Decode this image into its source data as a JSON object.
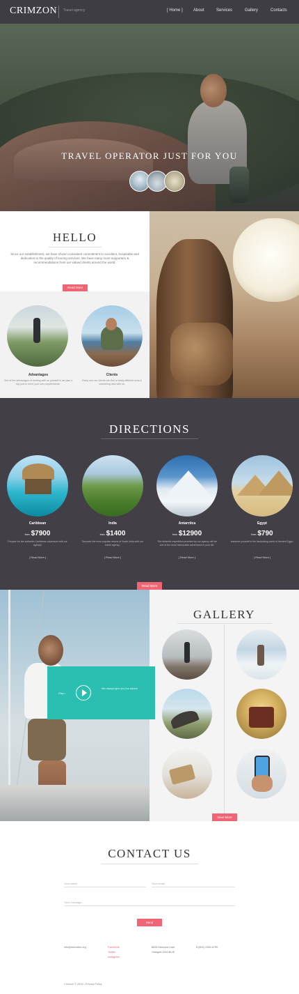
{
  "nav": {
    "brand": "CRIMZON",
    "tagline": "Travel agency",
    "items": [
      "[ Home ]",
      "About",
      "Services",
      "Gallery",
      "Contacts"
    ]
  },
  "hero": {
    "title": "TRAVEL OPERATOR JUST FOR YOU"
  },
  "hello": {
    "title": "HELLO",
    "text": "Since our establishment, we have shown consistent commitment to excellent, hospitable and dedication to the quality of touring services. We have many more supporters & recommendations from our valued clients around the world.",
    "button": "Read More",
    "features": [
      {
        "title": "Advantages",
        "text": "One of the advantages of dealing with us yourself is we plan a trip just to meet your own requirements."
      },
      {
        "title": "Clients",
        "text": "Every one our clients can find a totally different area & something new with us."
      }
    ]
  },
  "directions": {
    "title": "DIRECTIONS",
    "from_label": "from",
    "items": [
      {
        "name": "Caribbean",
        "price": "$7900",
        "text": "Prepare for the authentic Caribbean adventure with our agency!",
        "more": "[ Read More ]"
      },
      {
        "name": "India",
        "price": "$1400",
        "text": "Discover the most popular resorts of South India with our travel agency.",
        "more": "[ Read More ]"
      },
      {
        "name": "Antarctica",
        "price": "$12900",
        "text": "The Antarctic expedition provided by our agency will be one of the most memorable adventures in your life.",
        "more": "[ Read More ]"
      },
      {
        "name": "Egypt",
        "price": "$790",
        "text": "Immerse yourself in the fascinating world of Ancient Egypt.",
        "more": "[ Read More ]"
      }
    ],
    "button": "Read More"
  },
  "video": {
    "small_text": "Play •",
    "text": "We always give you fun advice"
  },
  "gallery": {
    "title": "GALLERY",
    "button": "View More"
  },
  "contact": {
    "title": "CONTACT US",
    "name_placeholder": "Your name",
    "email_placeholder": "Your email",
    "message_placeholder": "Your message",
    "send": "Send",
    "email": "info@demolink.org",
    "social": [
      "Facebook",
      "Twitter",
      "Instagram"
    ],
    "address": [
      "8628 Marcona road",
      "Glasgow DA4 8KJE"
    ],
    "phone": "8 (800) 2345-6790",
    "copyright": "Crimzon © 2016 • Privacy Policy"
  },
  "colors": {
    "accent": "#ef6574",
    "teal": "#2abfb1",
    "dark": "#423f47"
  }
}
